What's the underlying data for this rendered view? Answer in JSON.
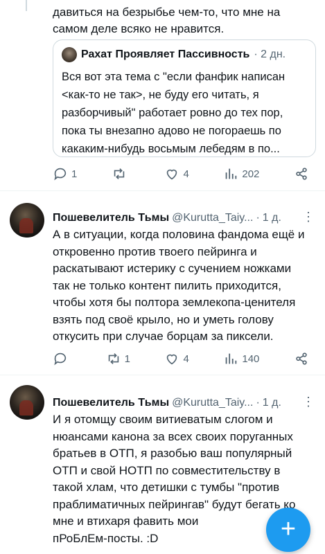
{
  "top_tweet": {
    "text_tail": "давиться на безрыбье чем-то, что мне на\nсамом деле всяко не нравится.",
    "quote": {
      "name": "Рахат Проявляет Пассивность",
      "time": "· 2 дн.",
      "text": "Вся вот эта тема с \"если фанфик написан\n<как-то не так>, не буду его читать, я\nразборчивый\" работает ровно до тех пор,\nпока ты внезапно адово не погораешь по\nкакаким-нибудь восьмым лебедям в по..."
    },
    "actions": {
      "replies": "1",
      "retweets": "",
      "likes": "4",
      "views": "202"
    }
  },
  "tweets": [
    {
      "name": "Пошевелитель Тьмы",
      "handle": "@Kurutta_Taiy...",
      "time": "1 д.",
      "text": "А в ситуации, когда половина фандома ещё и\nоткровенно против твоего пейринга и\nраскатывают истерику с сучением ножками\nтак не только контент пилить приходится,\nчтобы хотя бы полтора землекопа-ценителя\nвзять под своё крыло, но и уметь голову\nоткусить при случае борцам за пиксели.",
      "actions": {
        "replies": "",
        "retweets": "1",
        "likes": "4",
        "views": "140"
      }
    },
    {
      "name": "Пошевелитель Тьмы",
      "handle": "@Kurutta_Taiy...",
      "time": "1 д.",
      "text": "И я отомщу своим витиеватым слогом и\nнюансами канона за всех своих поруганных\nбратьев в ОТП, я разобью ваш популярный\nОТП и свой НОТП по совместительству в\nтакой хлам, что детишки с тумбы \"против\nпраблиматичных пейрингав\" будут бегать ко\nмне и втихаря фавить мои\nпРоБлЕм-посты. :D"
    }
  ],
  "fab": {
    "icon": "plus-icon"
  },
  "colors": {
    "accent": "#1d9bf0",
    "secondary_text": "#536471",
    "border": "#cfd9de"
  }
}
